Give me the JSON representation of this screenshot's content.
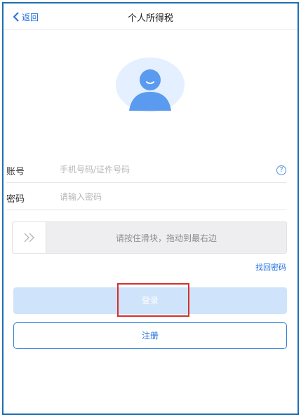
{
  "nav": {
    "back_label": "返回",
    "title": "个人所得税"
  },
  "form": {
    "account_label": "账号",
    "account_placeholder": "手机号码/证件号码",
    "password_label": "密码",
    "password_placeholder": "请输入密码",
    "help_icon": "question-circle-icon"
  },
  "slider": {
    "handle_icon": "double-chevron-right-icon",
    "hint": "请按住滑块，拖动到最右边"
  },
  "links": {
    "forgot_password": "找回密码"
  },
  "buttons": {
    "login_label": "登录",
    "register_label": "注册"
  },
  "colors": {
    "accent": "#1f6fe0",
    "login_button_bg": "#cfe3fa",
    "highlight_border": "#d4302c",
    "avatar_bg": "#e4efff",
    "avatar_figure": "#5a9bf0"
  }
}
